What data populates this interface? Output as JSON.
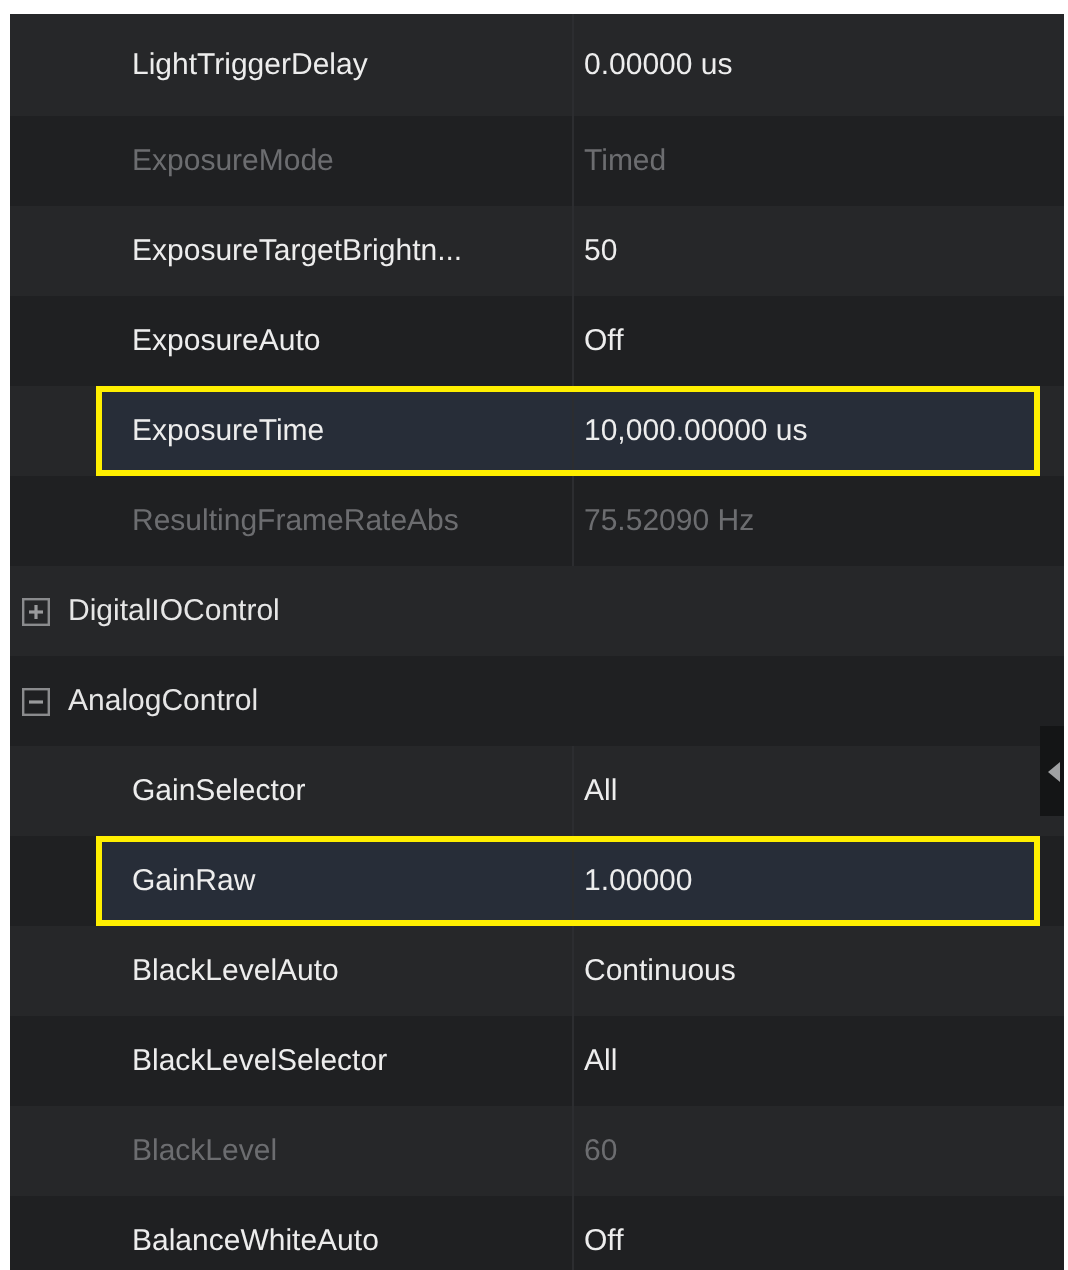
{
  "rows": [
    {
      "kind": "property",
      "name": "LightTriggerDelay",
      "value": "0.00000 us",
      "disabled": false,
      "selected": false
    },
    {
      "kind": "property",
      "name": "ExposureMode",
      "value": "Timed",
      "disabled": true,
      "selected": false
    },
    {
      "kind": "property",
      "name": "ExposureTargetBrightn...",
      "value": "50",
      "disabled": false,
      "selected": false
    },
    {
      "kind": "property",
      "name": "ExposureAuto",
      "value": "Off",
      "disabled": false,
      "selected": false
    },
    {
      "kind": "property",
      "name": "ExposureTime",
      "value": "10,000.00000 us",
      "disabled": false,
      "selected": true
    },
    {
      "kind": "property",
      "name": "ResultingFrameRateAbs",
      "value": "75.52090 Hz",
      "disabled": true,
      "selected": false
    },
    {
      "kind": "group",
      "name": "DigitalIOControl",
      "expanded": false
    },
    {
      "kind": "group",
      "name": "AnalogControl",
      "expanded": true,
      "children": [
        {
          "kind": "property",
          "name": "GainSelector",
          "value": "All",
          "disabled": false,
          "selected": false
        },
        {
          "kind": "property",
          "name": "GainRaw",
          "value": "1.00000",
          "disabled": false,
          "selected": true
        },
        {
          "kind": "property",
          "name": "BlackLevelAuto",
          "value": "Continuous",
          "disabled": false,
          "selected": false
        },
        {
          "kind": "property",
          "name": "BlackLevelSelector",
          "value": "All",
          "disabled": false,
          "selected": false
        },
        {
          "kind": "property",
          "name": "BlackLevel",
          "value": "60",
          "disabled": true,
          "selected": false
        },
        {
          "kind": "property",
          "name": "BalanceWhiteAuto",
          "value": "Off",
          "disabled": false,
          "selected": false
        }
      ]
    }
  ]
}
